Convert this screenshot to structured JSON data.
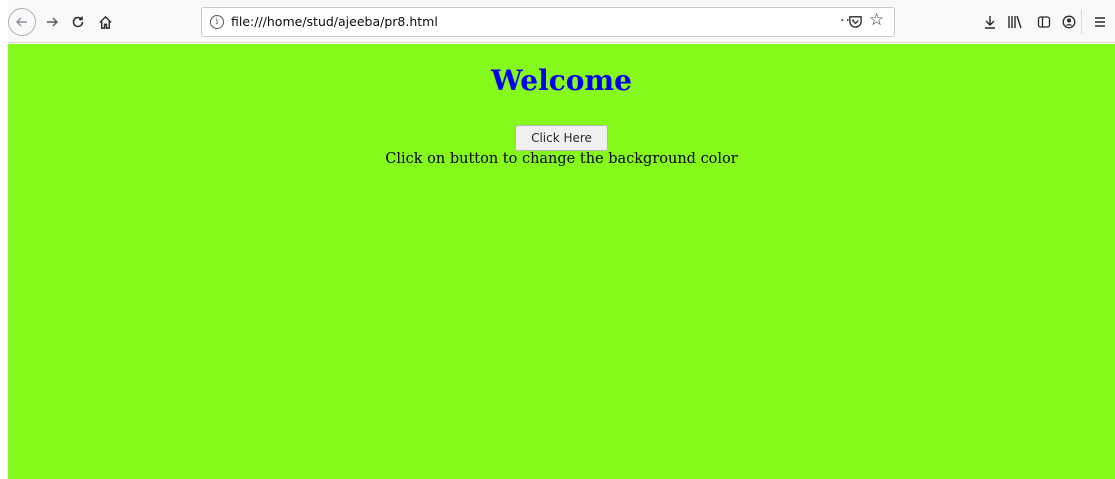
{
  "browser": {
    "url": "file:///home/stud/ajeeba/pr8.html",
    "page_actions_label": "···",
    "icons": {
      "back": "back-arrow-icon",
      "forward": "forward-arrow-icon",
      "reload": "reload-icon",
      "home": "home-icon",
      "info": "info-icon",
      "pocket": "pocket-icon",
      "bookmark": "star-icon",
      "download": "download-icon",
      "library": "library-icon",
      "sidebar": "sidebar-icon",
      "account": "account-icon",
      "menu": "hamburger-menu-icon"
    }
  },
  "page": {
    "background_color": "#86f91c",
    "heading": "Welcome",
    "heading_color": "#0000f0",
    "button_label": "Click Here",
    "hint_text": "Click on button to change the background color"
  }
}
